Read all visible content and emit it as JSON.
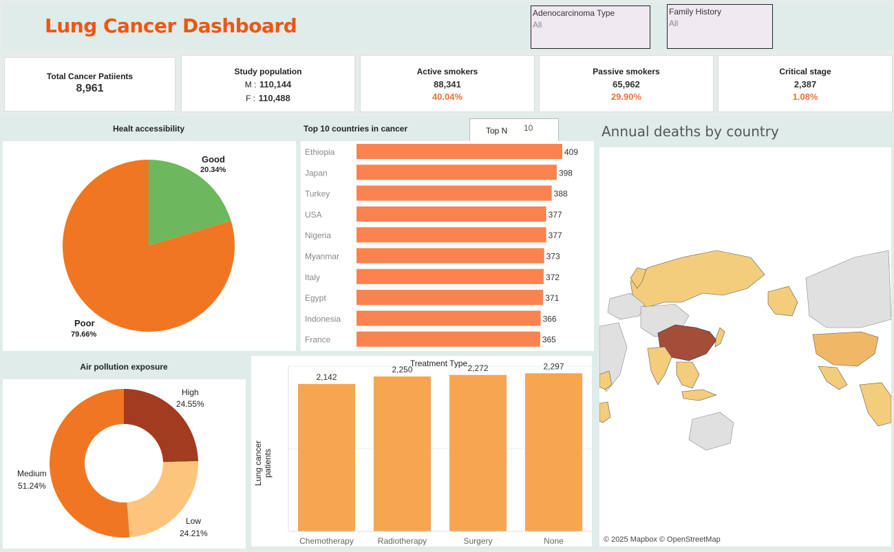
{
  "header": {
    "title": "Lung Cancer Dashboard",
    "filters": [
      {
        "label": "Adenocarcinoma Type",
        "value": "All"
      },
      {
        "label": "Family History",
        "value": "All"
      }
    ]
  },
  "kpis": {
    "total": {
      "label": "Total Cancer Patiients",
      "value": "8,961"
    },
    "study": {
      "label": "Study population",
      "m_label": "M :",
      "m_value": "110,144",
      "f_label": "F :",
      "f_value": "110,488"
    },
    "active": {
      "label": "Active smokers",
      "value": "88,341",
      "pct": "40.04%"
    },
    "passive": {
      "label": "Passive smokers",
      "value": "65,962",
      "pct": "29.90%"
    },
    "critical": {
      "label": "Critical stage",
      "value": "2,387",
      "pct": "1.08%"
    }
  },
  "health": {
    "title": "Healt accessibility",
    "slices": [
      {
        "name": "Good",
        "pct": "20.34%",
        "value": 20.34,
        "color": "#6db85c"
      },
      {
        "name": "Poor",
        "pct": "79.66%",
        "value": 79.66,
        "color": "#f07622"
      }
    ]
  },
  "top10": {
    "title": "Top 10 countries in cancer",
    "topn_label": "Top N",
    "topn_value": "10",
    "color": "#fb8350",
    "rows": [
      {
        "country": "Ethiopia",
        "value": 409,
        "label": "409"
      },
      {
        "country": "Japan",
        "value": 398,
        "label": "398"
      },
      {
        "country": "Turkey",
        "value": 388,
        "label": "388"
      },
      {
        "country": "USA",
        "value": 377,
        "label": "377"
      },
      {
        "country": "Nigeria",
        "value": 377,
        "label": "377"
      },
      {
        "country": "Myanmar",
        "value": 373,
        "label": "373"
      },
      {
        "country": "Italy",
        "value": 372,
        "label": "372"
      },
      {
        "country": "Egypt",
        "value": 371,
        "label": "371"
      },
      {
        "country": "Indonesia",
        "value": 366,
        "label": "366"
      },
      {
        "country": "France",
        "value": 365,
        "label": "365"
      }
    ]
  },
  "map": {
    "title": "Annual deaths by country",
    "attribution": "© 2025 Mapbox © OpenStreetMap"
  },
  "pollution": {
    "title": "Air pollution exposure",
    "slices": [
      {
        "name": "High",
        "pct": "24.55%",
        "value": 24.55,
        "color": "#a23b1f"
      },
      {
        "name": "Low",
        "pct": "24.21%",
        "value": 24.21,
        "color": "#fdc47e"
      },
      {
        "name": "Medium",
        "pct": "51.24%",
        "value": 51.24,
        "color": "#f07622"
      }
    ]
  },
  "chart_data": [
    {
      "type": "pie",
      "title": "Healt accessibility",
      "categories": [
        "Good",
        "Poor"
      ],
      "values": [
        20.34,
        79.66
      ]
    },
    {
      "type": "bar",
      "title": "Top 10 countries in cancer",
      "categories": [
        "Ethiopia",
        "Japan",
        "Turkey",
        "USA",
        "Nigeria",
        "Myanmar",
        "Italy",
        "Egypt",
        "Indonesia",
        "France"
      ],
      "values": [
        409,
        398,
        388,
        377,
        377,
        373,
        372,
        371,
        366,
        365
      ]
    },
    {
      "type": "pie",
      "title": "Air pollution exposure",
      "categories": [
        "High",
        "Low",
        "Medium"
      ],
      "values": [
        24.55,
        24.21,
        51.24
      ]
    },
    {
      "type": "bar",
      "title": "Treatment Type",
      "ylabel": "Lung cancer patients",
      "categories": [
        "Chemotherapy",
        "Radiotherapy",
        "Surgery",
        "None"
      ],
      "values": [
        2142,
        2250,
        2272,
        2297
      ],
      "labels": [
        "2,142",
        "2,250",
        "2,272",
        "2,297"
      ],
      "color": "#f7a550",
      "ylim": [
        0,
        2400
      ]
    }
  ]
}
